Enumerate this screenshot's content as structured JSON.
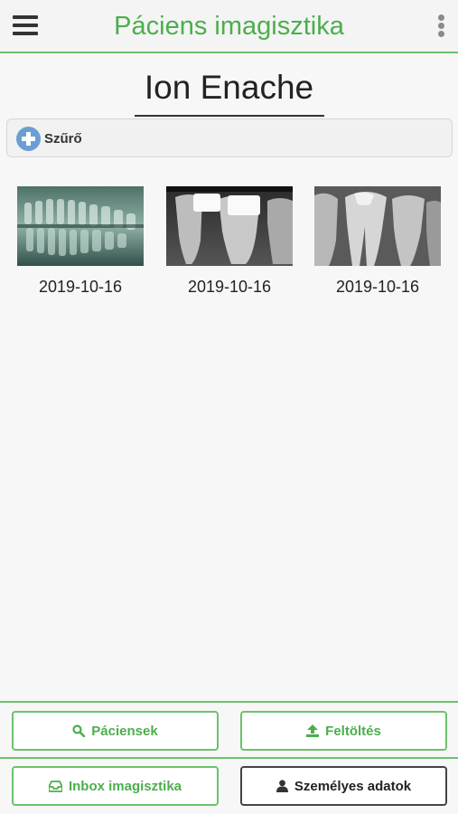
{
  "header": {
    "title": "Páciens imagisztika"
  },
  "patient": {
    "name": "Ion Enache"
  },
  "filter": {
    "label": "Szűrő"
  },
  "images": [
    {
      "date": "2019-10-16"
    },
    {
      "date": "2019-10-16"
    },
    {
      "date": "2019-10-16"
    }
  ],
  "footer": {
    "patients_label": "Páciensek",
    "upload_label": "Feltöltés",
    "inbox_label": "Inbox imagisztika",
    "personal_label": "Személyes adatok"
  },
  "colors": {
    "accent": "#4cae4c",
    "border_accent": "#6cc26c",
    "filter_icon": "#6b9fd4"
  }
}
